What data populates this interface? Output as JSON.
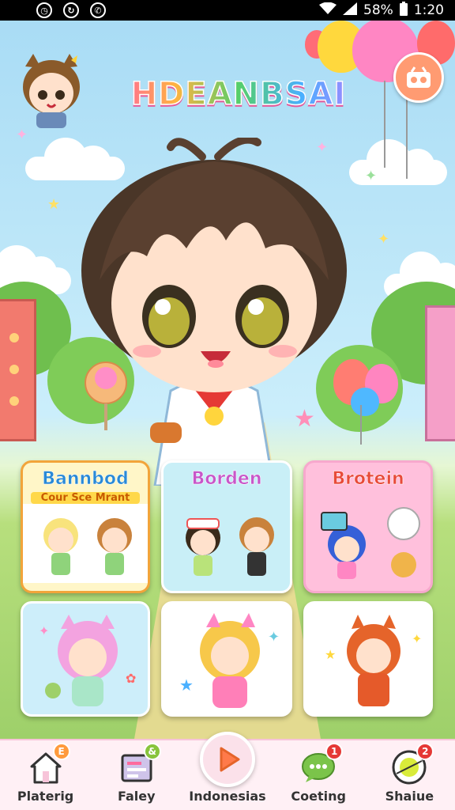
{
  "status_bar": {
    "left_icons": [
      "alarm-icon",
      "sync-icon",
      "whatsapp-icon"
    ],
    "battery": "58%",
    "time": "1:20"
  },
  "header": {
    "logo_text": "HDEANBSAI",
    "shop_icon": "shop-icon"
  },
  "cards": [
    {
      "title": "Bannbod",
      "subtitle": "Cour Sce Mrant",
      "title_color": "#2a8ad6"
    },
    {
      "title": "Borden",
      "subtitle": "",
      "title_color": "#c757c9"
    },
    {
      "title": "Brotein",
      "subtitle": "",
      "title_color": "#e84a3a"
    },
    {
      "title": "",
      "subtitle": ""
    },
    {
      "title": "",
      "subtitle": ""
    },
    {
      "title": "",
      "subtitle": ""
    }
  ],
  "nav": [
    {
      "label": "Platerig",
      "icon": "home-icon",
      "badge": "E",
      "badge_color": "#ff9a3c"
    },
    {
      "label": "Faley",
      "icon": "calendar-icon",
      "badge": "&",
      "badge_color": "#88c43c"
    },
    {
      "label": "Indonesias",
      "icon": "play-icon",
      "badge": "",
      "badge_color": ""
    },
    {
      "label": "Coeting",
      "icon": "chat-icon",
      "badge": "1",
      "badge_color": "#e53935"
    },
    {
      "label": "Shaiue",
      "icon": "gift-icon",
      "badge": "2",
      "badge_color": "#e53935"
    }
  ],
  "colors": {
    "accent_pink": "#ff86c3",
    "nav_bg": "#fff0f5",
    "sky": "#a9dcf5"
  }
}
